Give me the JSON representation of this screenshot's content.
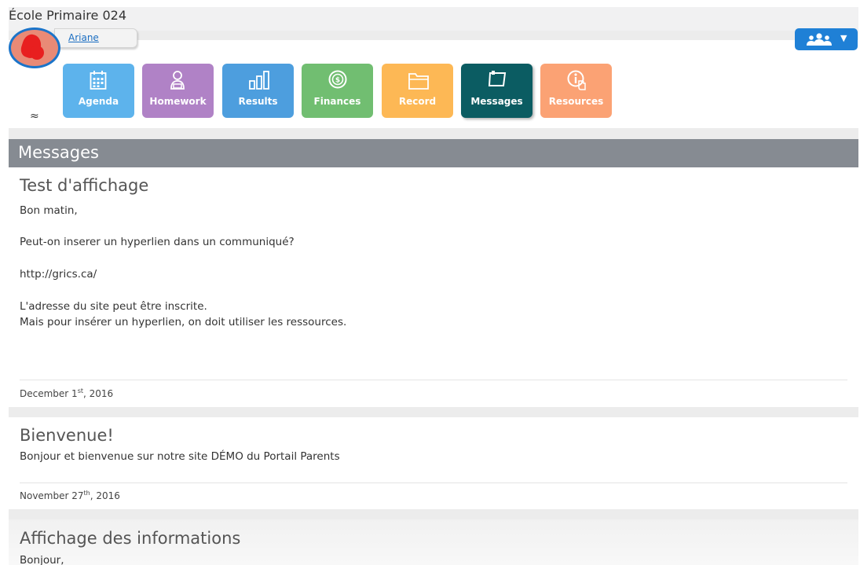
{
  "header": {
    "school_name": "École Primaire 024",
    "user_name": "Ariane",
    "group_icon": "users-icon"
  },
  "nav": {
    "tiles": [
      {
        "label": "Agenda",
        "icon": "calendar-icon",
        "color": "#5db3ec"
      },
      {
        "label": "Homework",
        "icon": "student-icon",
        "color": "#b082c6"
      },
      {
        "label": "Results",
        "icon": "bar-chart-icon",
        "color": "#4d9ede"
      },
      {
        "label": "Finances",
        "icon": "dollar-coin-icon",
        "color": "#71be71"
      },
      {
        "label": "Record",
        "icon": "folder-icon",
        "color": "#fdb855"
      },
      {
        "label": "Messages",
        "icon": "note-icon",
        "color": "#0b5c62"
      },
      {
        "label": "Resources",
        "icon": "info-hand-icon",
        "color": "#fba274"
      }
    ],
    "collapse_glyph": "≈"
  },
  "section": {
    "title": "Messages"
  },
  "messages": [
    {
      "title": "Test d'affichage",
      "lines": [
        "Bon matin,",
        "Peut-on inserer un hyperlien dans un communiqué?",
        "http://grics.ca/",
        "L'adresse du site peut être inscrite.",
        "Mais pour insérer un hyperlien, on doit utiliser les ressources."
      ],
      "date_month_day": "December 1",
      "date_suffix": "st",
      "date_year": ", 2016"
    },
    {
      "title": "Bienvenue!",
      "lines": [
        "Bonjour et bienvenue sur notre site DÉMO du Portail Parents"
      ],
      "date_month_day": "November 27",
      "date_suffix": "th",
      "date_year": ", 2016"
    },
    {
      "title": "Affichage des informations",
      "lines": [
        "Bonjour,"
      ]
    }
  ]
}
